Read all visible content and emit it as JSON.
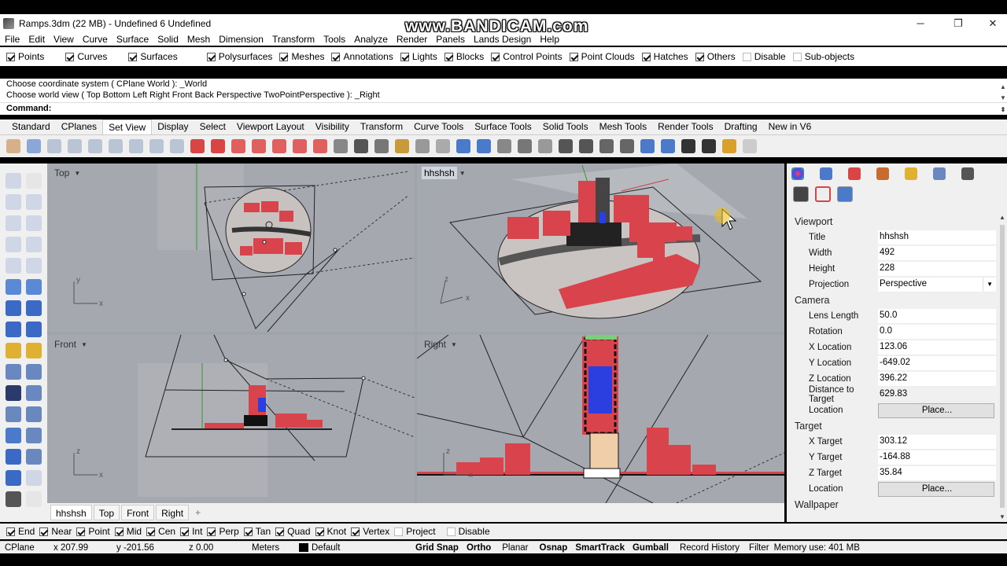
{
  "window": {
    "title": "Ramps.3dm (22 MB) - Undefined 6 Undefined",
    "watermark": "www.BANDICAM.com",
    "minimize": "─",
    "maximize": "❐",
    "close": "✕"
  },
  "menu": [
    "File",
    "Edit",
    "View",
    "Curve",
    "Surface",
    "Solid",
    "Mesh",
    "Dimension",
    "Transform",
    "Tools",
    "Analyze",
    "Render",
    "Panels",
    "Lands Design",
    "Help"
  ],
  "filters": [
    {
      "label": "Points",
      "checked": true
    },
    {
      "label": "Curves",
      "checked": true
    },
    {
      "label": "Surfaces",
      "checked": true
    },
    {
      "label": "Polysurfaces",
      "checked": true
    },
    {
      "label": "Meshes",
      "checked": true
    },
    {
      "label": "Annotations",
      "checked": true
    },
    {
      "label": "Lights",
      "checked": true
    },
    {
      "label": "Blocks",
      "checked": true
    },
    {
      "label": "Control Points",
      "checked": true
    },
    {
      "label": "Point Clouds",
      "checked": true
    },
    {
      "label": "Hatches",
      "checked": true
    },
    {
      "label": "Others",
      "checked": true
    },
    {
      "label": "Disable",
      "checked": false
    },
    {
      "label": "Sub-objects",
      "checked": false
    }
  ],
  "command": {
    "history1": "Choose coordinate system ( CPlane  World ): _World",
    "history2": "Choose world view ( Top  Bottom  Left  Right  Front  Back  Perspective  TwoPointPerspective ): _Right",
    "prompt": "Command:"
  },
  "tabs": [
    "Standard",
    "CPlanes",
    "Set View",
    "Display",
    "Select",
    "Viewport Layout",
    "Visibility",
    "Transform",
    "Curve Tools",
    "Surface Tools",
    "Solid Tools",
    "Mesh Tools",
    "Render Tools",
    "Drafting",
    "New in V6"
  ],
  "active_tab": "Set View",
  "viewports": {
    "top": "Top",
    "persp": "hhshsh",
    "front": "Front",
    "right": "Right"
  },
  "axis": {
    "x": "x",
    "y": "y",
    "z": "z"
  },
  "viewport_tabs": [
    "hhshsh",
    "Top",
    "Front",
    "Right"
  ],
  "viewport_tab_add": "+",
  "panel": {
    "viewport_header": "Viewport",
    "viewport": [
      {
        "k": "Title",
        "v": "hhshsh"
      },
      {
        "k": "Width",
        "v": "492"
      },
      {
        "k": "Height",
        "v": "228"
      },
      {
        "k": "Projection",
        "v": "Perspective"
      }
    ],
    "camera_header": "Camera",
    "camera": [
      {
        "k": "Lens Length",
        "v": "50.0"
      },
      {
        "k": "Rotation",
        "v": "0.0"
      },
      {
        "k": "X Location",
        "v": "123.06"
      },
      {
        "k": "Y Location",
        "v": "-649.02"
      },
      {
        "k": "Z Location",
        "v": "396.22"
      },
      {
        "k": "Distance to Target",
        "v": "629.83"
      },
      {
        "k": "Location",
        "v": "Place..."
      }
    ],
    "target_header": "Target",
    "target": [
      {
        "k": "X Target",
        "v": "303.12"
      },
      {
        "k": "Y Target",
        "v": "-164.88"
      },
      {
        "k": "Z Target",
        "v": "35.84"
      },
      {
        "k": "Location",
        "v": "Place..."
      }
    ],
    "wallpaper_header": "Wallpaper"
  },
  "osnaps": [
    {
      "label": "End",
      "checked": true
    },
    {
      "label": "Near",
      "checked": true
    },
    {
      "label": "Point",
      "checked": true
    },
    {
      "label": "Mid",
      "checked": true
    },
    {
      "label": "Cen",
      "checked": true
    },
    {
      "label": "Int",
      "checked": true
    },
    {
      "label": "Perp",
      "checked": true
    },
    {
      "label": "Tan",
      "checked": true
    },
    {
      "label": "Quad",
      "checked": true
    },
    {
      "label": "Knot",
      "checked": true
    },
    {
      "label": "Vertex",
      "checked": true
    },
    {
      "label": "Project",
      "checked": false
    },
    {
      "label": "Disable",
      "checked": false
    }
  ],
  "status": {
    "cplane": "CPlane",
    "x": "x 207.99",
    "y": "y -201.56",
    "z": "z 0.00",
    "units": "Meters",
    "layer": "Default",
    "grid_snap": "Grid Snap",
    "ortho": "Ortho",
    "planar": "Planar",
    "osnap": "Osnap",
    "smarttrack": "SmartTrack",
    "gumball": "Gumball",
    "record_history": "Record History",
    "filter": "Filter",
    "memory": "Memory use: 401 MB"
  },
  "colors": {
    "building_red": "#d9434b",
    "viewport_bg": "#a5a8ae",
    "accent_blue": "#2b3fe0"
  }
}
